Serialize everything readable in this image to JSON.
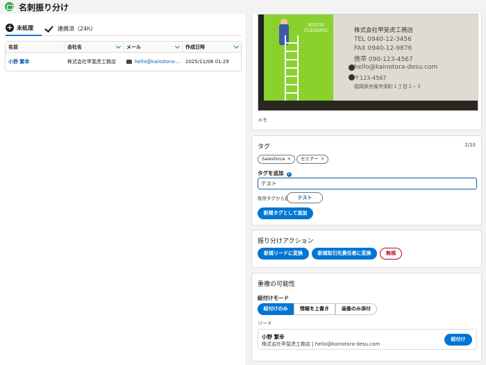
{
  "app": {
    "title": "名刺振り分け",
    "icon": "business-card-icon",
    "accent": "#0176d3"
  },
  "tabs": [
    {
      "label": "未処理",
      "icon": "add-circle-icon",
      "active": true
    },
    {
      "label": "連携済（24h）",
      "icon": "check-icon",
      "active": false
    }
  ],
  "table": {
    "columns": [
      "名前",
      "会社名",
      "メール",
      "作成日時"
    ],
    "rows": [
      {
        "name": "小野 繁幸",
        "company": "株式会社甲斐虎工務店",
        "email": "hello@kainotora-...",
        "created": "2025/11/08 01:29"
      }
    ]
  },
  "card_image": {
    "company": "株式会社甲斐虎工務店",
    "house_text": "HOUSE\nCLEANING",
    "tel": "TEL 0940-12-3456",
    "fax": "FAX 0940-12-9876",
    "mobile": "携帯 090-123-4567",
    "email": "hello@kainotora-desu.com",
    "zip": "〒123-4567",
    "address": "福岡県宗像市栄町１丁目２−３"
  },
  "memo": {
    "label": "メモ"
  },
  "tags": {
    "title": "タグ",
    "count": "2/10",
    "selected": [
      "Salesforce",
      "セミナー"
    ],
    "add_label": "タグを追加",
    "input_value": "テスト",
    "existing_label": "既存タグから選択",
    "existing": [
      "テスト"
    ],
    "add_button": "新規タグとして追加"
  },
  "actions": {
    "title": "振り分けアクション",
    "new_lead": "新規リードに変換",
    "new_contact": "新規取引先責任者に変換",
    "ignore": "無視"
  },
  "duplicates": {
    "title": "重複の可能性",
    "mode_label": "紐付けモード",
    "modes": [
      "紐付けのみ",
      "情報を上書き",
      "画像のみ添付"
    ],
    "active_mode": 0,
    "lead_label": "リード",
    "lead": {
      "name": "小野 繁幸",
      "sub": "株式会社甲斐虎工務店 | hello@kainotora-desu.com",
      "button": "紐付け"
    }
  }
}
